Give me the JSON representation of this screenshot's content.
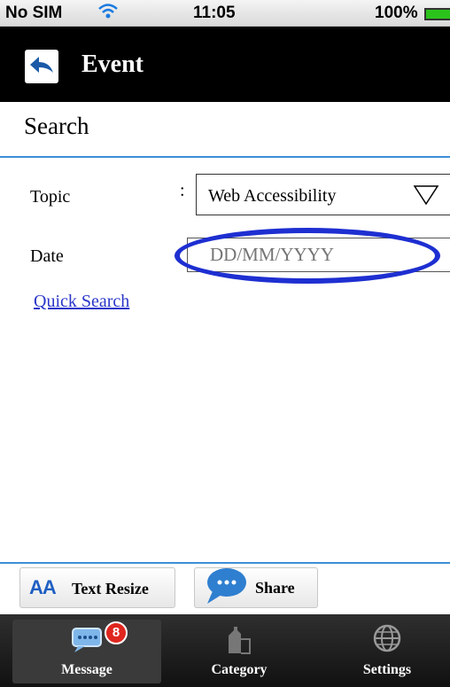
{
  "status_bar": {
    "carrier": "No SIM",
    "wifi_icon": "wifi-icon",
    "time": "11:05",
    "battery": "100%",
    "battery_icon": "battery-icon"
  },
  "header": {
    "back_icon": "back-arrow-icon",
    "title": "Event"
  },
  "search": {
    "title": "Search",
    "topic_label": "Topic",
    "topic_separator": ":",
    "topic_value": "Web Accessibility",
    "date_label": "Date",
    "date_placeholder": "DD/MM/YYYY",
    "quick_search_link": "Quick Search"
  },
  "toolbar": {
    "text_resize_icon": "AA",
    "text_resize_label": "Text Resize",
    "share_label": "Share"
  },
  "tabbar": {
    "tabs": [
      {
        "label": "Message",
        "icon": "message-icon",
        "badge": "8",
        "selected": true
      },
      {
        "label": "Category",
        "icon": "category-icon"
      },
      {
        "label": "Settings",
        "icon": "globe-icon"
      }
    ]
  },
  "colors": {
    "accent_blue": "#3d8fd6",
    "link_blue": "#2a36c9",
    "highlight_ring": "#1e2fd1",
    "badge_red": "#e0261e"
  }
}
